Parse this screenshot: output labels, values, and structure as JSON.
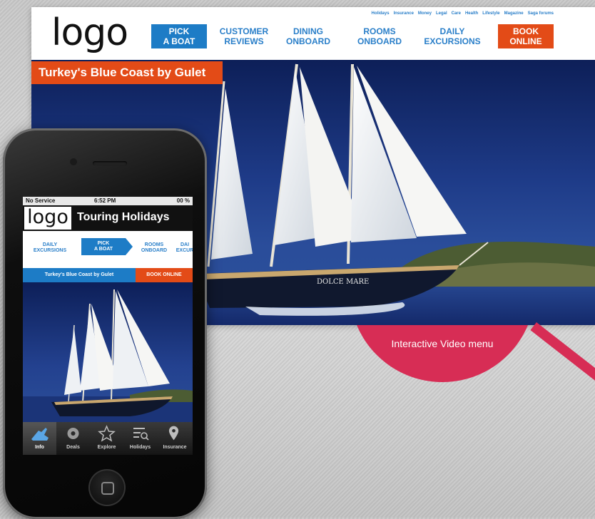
{
  "site": {
    "logo": "logo",
    "top_links": [
      "Holidays",
      "Insurance",
      "Money",
      "Legal",
      "Care",
      "Health",
      "Lifestyle",
      "Magazine",
      "Saga forums"
    ],
    "nav": [
      {
        "label": "PICK\nA BOAT",
        "state": "active"
      },
      {
        "label": "CUSTOMER\nREVIEWS",
        "state": "normal"
      },
      {
        "label": "DINING\nONBOARD",
        "state": "normal"
      },
      {
        "label": "ROOMS\nONBOARD",
        "state": "normal"
      },
      {
        "label": "DAILY\nEXCURSIONS",
        "state": "normal"
      },
      {
        "label": "BOOK\nONLINE",
        "state": "book"
      }
    ],
    "hero_title": "Turkey's Blue Coast by Gulet",
    "boat_name": "DOLCE MARE",
    "video_menu_label": "Interactive Video menu"
  },
  "phone": {
    "status": {
      "carrier": "No Service",
      "time": "6:52 PM",
      "battery": "00 %"
    },
    "logo": "logo",
    "header_title": "Touring Holidays",
    "nav": [
      {
        "label": "DAILY\nEXCURSIONS",
        "state": "normal"
      },
      {
        "label": "PICK\nA BOAT",
        "state": "active"
      },
      {
        "label": "ROOMS\nONBOARD",
        "state": "normal"
      },
      {
        "label": "DAI\nEXCUR",
        "state": "normal"
      }
    ],
    "banner_title": "Turkey's Blue Coast by Gulet",
    "book_label": "BOOK ONLINE",
    "tabs": [
      {
        "label": "Info",
        "icon": "info-icon",
        "active": true
      },
      {
        "label": "Deals",
        "icon": "gear-icon",
        "active": false
      },
      {
        "label": "Explore",
        "icon": "star-icon",
        "active": false
      },
      {
        "label": "Holidays",
        "icon": "list-search-icon",
        "active": false
      },
      {
        "label": "Insurance",
        "icon": "map-pin-icon",
        "active": false
      }
    ]
  },
  "colors": {
    "accent_blue": "#1d7cc6",
    "accent_orange": "#e34b17",
    "video_menu_pink": "#d72d55",
    "sea_blue": "#1e3b88"
  }
}
